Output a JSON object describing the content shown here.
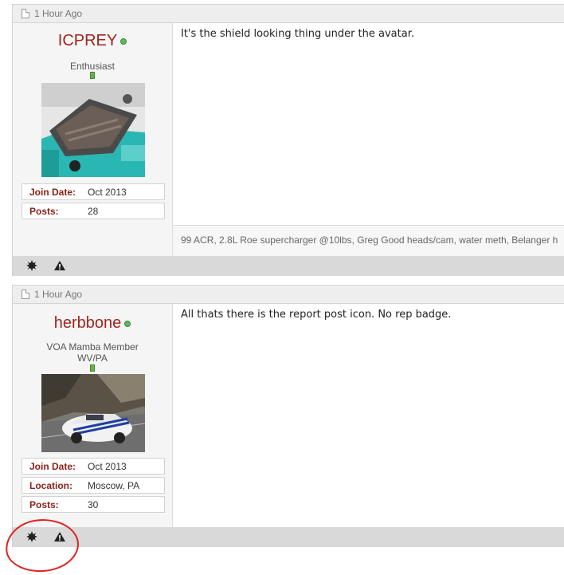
{
  "posts": [
    {
      "time": "1 Hour Ago",
      "username": "ICPREY",
      "usertitle": [
        "Enthusiast"
      ],
      "avatar_icon": "engine-bay-photo",
      "fields": [
        {
          "label": "Join Date:",
          "value": "Oct 2013"
        },
        {
          "label": "Posts:",
          "value": "28"
        }
      ],
      "message": "It's the shield looking thing under the avatar.",
      "signature": "99 ACR, 2.8L Roe supercharger @10lbs, Greg Good heads/cam, water meth, Belanger h"
    },
    {
      "time": "1 Hour Ago",
      "username": "herbbone",
      "usertitle": [
        "VOA Mamba Member",
        "WV/PA"
      ],
      "avatar_icon": "white-viper-photo",
      "fields": [
        {
          "label": "Join Date:",
          "value": "Oct 2013"
        },
        {
          "label": "Location:",
          "value": "Moscow, PA"
        },
        {
          "label": "Posts:",
          "value": "30"
        }
      ],
      "message": "All thats there is the report post icon. No rep badge.",
      "signature": ""
    }
  ],
  "footer_icons": [
    "reputation-star-icon",
    "report-post-icon"
  ],
  "colors": {
    "username": "#a0251e",
    "field_label": "#8b1f17",
    "online": "#5cb85c",
    "annotation": "#e22020"
  }
}
